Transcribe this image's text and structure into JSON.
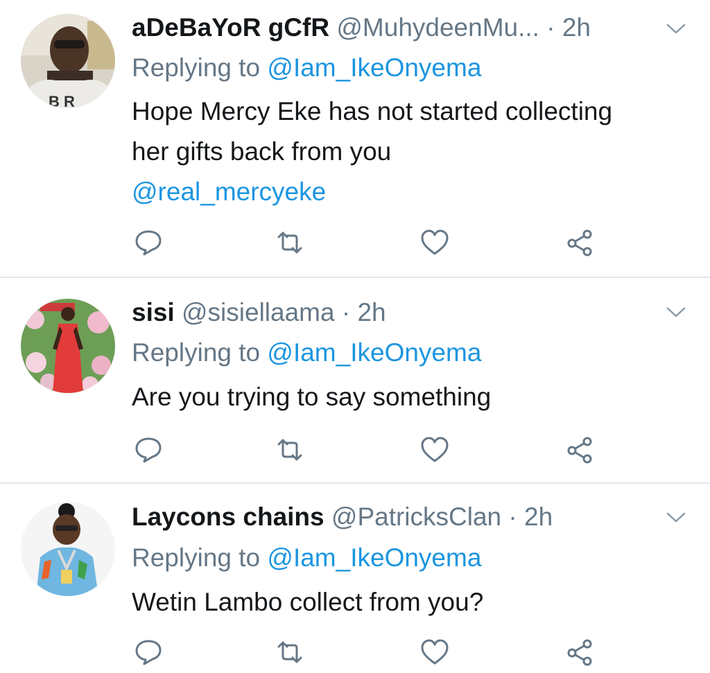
{
  "tweets": [
    {
      "display_name": "aDeBaYoR gCfR",
      "handle": "@MuhydeenMu...",
      "separator": "·",
      "time": "2h",
      "replying_prefix": "Replying to",
      "replying_to": "@Iam_IkeOnyema",
      "text": "Hope Mercy Eke has not started collecting her gifts back from you",
      "mention": "@real_mercyeke",
      "avatar_shirt_text": "B R"
    },
    {
      "display_name": "sisi",
      "handle": "@sisiellaama",
      "separator": "·",
      "time": "2h",
      "replying_prefix": "Replying to",
      "replying_to": "@Iam_IkeOnyema",
      "text": "Are you trying to say something"
    },
    {
      "display_name": "Laycons chains",
      "handle": "@PatricksClan",
      "separator": "·",
      "time": "2h",
      "replying_prefix": "Replying to",
      "replying_to": "@Iam_IkeOnyema",
      "text": "Wetin Lambo collect from you?"
    }
  ],
  "icons": {
    "reply": "reply-icon",
    "retweet": "retweet-icon",
    "like": "heart-icon",
    "share": "share-icon",
    "menu": "chevron-down-icon"
  },
  "colors": {
    "link": "#1b95e0",
    "secondary_text": "#657786",
    "primary_text": "#14171a",
    "divider": "#e1e8ed"
  }
}
